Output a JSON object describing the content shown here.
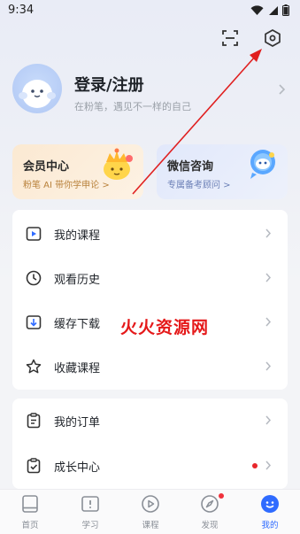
{
  "status_bar": {
    "time": "9:34"
  },
  "profile": {
    "title": "登录/注册",
    "subtitle": "在粉笔，遇见不一样的自己"
  },
  "promos": [
    {
      "title": "会员中心",
      "subtitle": "粉笔 AI 带你学申论 >"
    },
    {
      "title": "微信咨询",
      "subtitle": "专属备考顾问 >"
    }
  ],
  "menu_group_1": [
    {
      "label": "我的课程",
      "icon": "video-course-icon"
    },
    {
      "label": "观看历史",
      "icon": "clock-icon"
    },
    {
      "label": "缓存下载",
      "icon": "download-icon"
    },
    {
      "label": "收藏课程",
      "icon": "star-icon"
    }
  ],
  "menu_group_2": [
    {
      "label": "我的订单",
      "icon": "clipboard-icon"
    },
    {
      "label": "成长中心",
      "icon": "growth-icon"
    }
  ],
  "watermark": "火火资源网",
  "tabbar": [
    {
      "label": "首页",
      "icon": "home-book-icon"
    },
    {
      "label": "学习",
      "icon": "study-icon"
    },
    {
      "label": "课程",
      "icon": "play-course-icon"
    },
    {
      "label": "发现",
      "icon": "compass-icon"
    },
    {
      "label": "我的",
      "icon": "profile-face-icon"
    }
  ],
  "colors": {
    "accent": "#2f6bff",
    "annotation_arrow": "#e02020",
    "badge": "#e8262b"
  }
}
